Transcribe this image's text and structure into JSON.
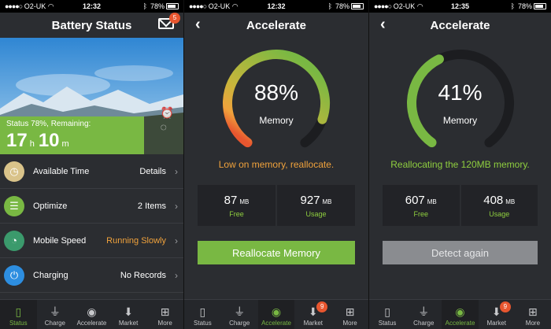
{
  "statusbar": {
    "carrier": "O2-UK",
    "battery": "78%",
    "times": [
      "12:32",
      "12:32",
      "12:35"
    ]
  },
  "screen1": {
    "title": "Battery Status",
    "mail_badge": "5",
    "status_line": "Status 78%, Remaining:",
    "hours": "17",
    "hours_unit": "h",
    "minutes": "10",
    "minutes_unit": "m",
    "rows": [
      {
        "label": "Available Time",
        "value": "Details",
        "icon": "clock-icon",
        "color": "#d9c38a"
      },
      {
        "label": "Optimize",
        "value": "2 Items",
        "icon": "list-icon",
        "color": "#79b843"
      },
      {
        "label": "Mobile Speed",
        "value": "Running Slowly",
        "icon": "speedometer-icon",
        "color": "#3b9a6c",
        "value_color": "#f0a23c"
      },
      {
        "label": "Charging",
        "value": "No Records",
        "icon": "plug-icon",
        "color": "#2d8ee0"
      }
    ]
  },
  "screen2": {
    "title": "Accelerate",
    "percent": "88%",
    "percent_value": 0.88,
    "gauge_label": "Memory",
    "message": "Low on memory, reallocate.",
    "free_value": "87",
    "free_unit": "MB",
    "free_label": "Free",
    "usage_value": "927",
    "usage_unit": "MB",
    "usage_label": "Usage",
    "button": "Reallocate Memory"
  },
  "screen3": {
    "title": "Accelerate",
    "percent": "41%",
    "percent_value": 0.41,
    "gauge_label": "Memory",
    "message": "Reallocating the 120MB memory.",
    "free_value": "607",
    "free_unit": "MB",
    "free_label": "Free",
    "usage_value": "408",
    "usage_unit": "MB",
    "usage_label": "Usage",
    "button": "Detect again"
  },
  "tabs": {
    "labels": [
      "Status",
      "Charge",
      "Accelerate",
      "Market",
      "More"
    ],
    "icons": [
      "battery-icon",
      "plug-icon",
      "rocket-icon",
      "download-icon",
      "grid-icon"
    ],
    "market_badge": "9"
  },
  "colors": {
    "accent_green": "#79b843",
    "warning_orange": "#f0a23c",
    "gauge_red": "#e8562f",
    "background": "#2b2d31"
  }
}
